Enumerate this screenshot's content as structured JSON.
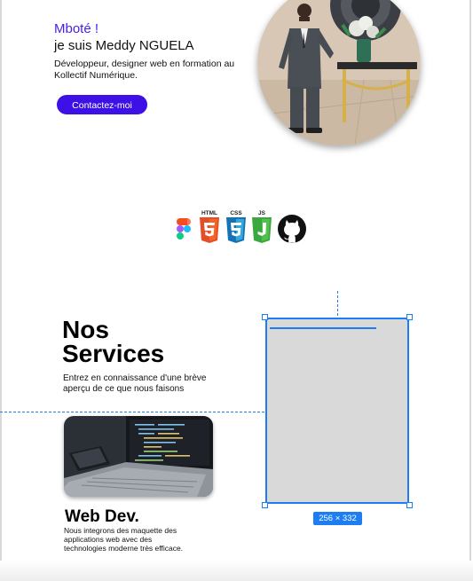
{
  "hero": {
    "greeting": "Mboté !",
    "name": "je suis Meddy NGUELA",
    "tagline": "Développeur, designer web en formation au Kollectif Numérique.",
    "contact_label": "Contactez-moi"
  },
  "skills": {
    "html_label": "HTML",
    "css_label": "CSS",
    "js_label": "JS",
    "icons": [
      "figma-icon",
      "html5-icon",
      "css3-icon",
      "js-icon",
      "github-icon"
    ]
  },
  "services": {
    "title_line1": "Nos",
    "title_line2": "Services",
    "description": "Entrez en connaissance d'une brève aperçu de ce que nous faisons"
  },
  "selection": {
    "size_label": "256 × 332"
  },
  "service_card": {
    "title": "Web Dev.",
    "description": "Nous integrons des maquette des applications web avec des technologies moderne très efficace."
  },
  "colors": {
    "accent": "#3d10e6",
    "greeting": "#4a1ee8",
    "selection": "#1c7ef2",
    "placeholder": "#d9d9d9"
  }
}
